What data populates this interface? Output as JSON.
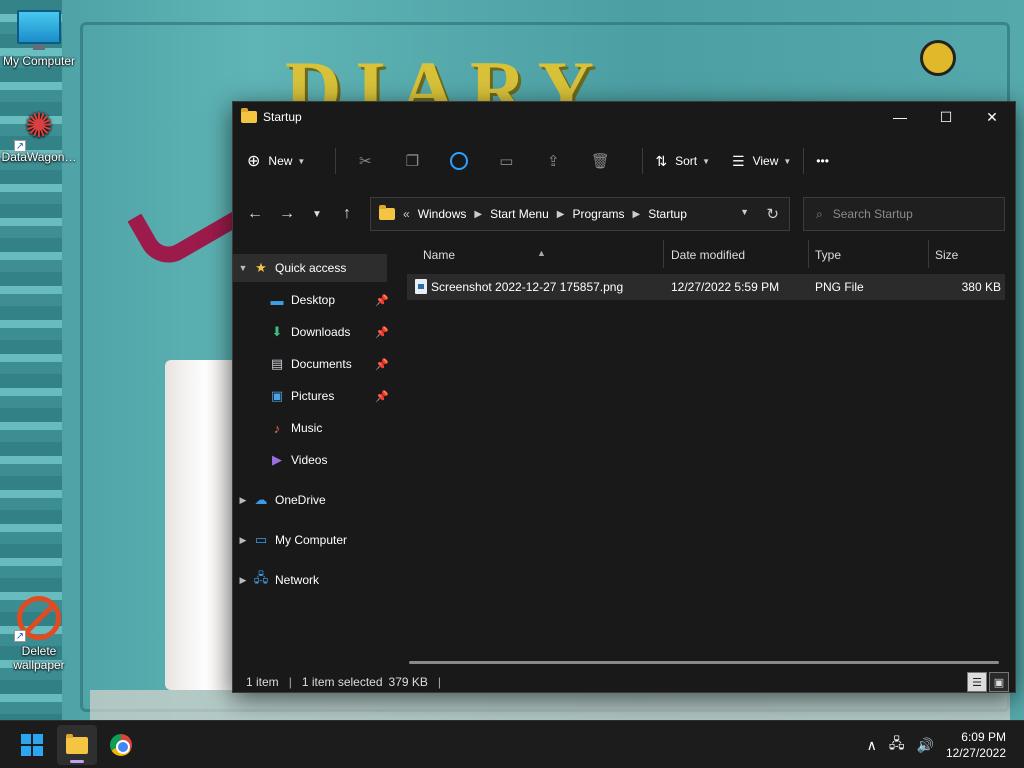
{
  "desktop": {
    "icons": [
      {
        "label": "My Computer",
        "icon": "monitor-icon"
      },
      {
        "label": "DataWagon…",
        "icon": "datawagon-icon"
      },
      {
        "label": "Delete wallpaper",
        "icon": "no-entry-icon"
      }
    ],
    "wallpaper_title": "DIARY"
  },
  "window": {
    "title": "Startup",
    "controls": {
      "minimize": "—",
      "maximize": "☐",
      "close": "✕"
    },
    "toolbar": {
      "new_label": "New",
      "sort_label": "Sort",
      "view_label": "View",
      "more_label": "•••"
    },
    "address": {
      "prefix": "«",
      "crumbs": [
        "Windows",
        "Start Menu",
        "Programs",
        "Startup"
      ]
    },
    "search": {
      "placeholder": "Search Startup"
    },
    "nav": {
      "quick_access": "Quick access",
      "items": [
        {
          "label": "Desktop",
          "icon": "desktop-icon",
          "pinned": true
        },
        {
          "label": "Downloads",
          "icon": "download-icon",
          "pinned": true
        },
        {
          "label": "Documents",
          "icon": "document-icon",
          "pinned": true
        },
        {
          "label": "Pictures",
          "icon": "pictures-icon",
          "pinned": true
        },
        {
          "label": "Music",
          "icon": "music-icon",
          "pinned": false
        },
        {
          "label": "Videos",
          "icon": "videos-icon",
          "pinned": false
        }
      ],
      "onedrive": "OneDrive",
      "my_computer": "My Computer",
      "network": "Network"
    },
    "columns": [
      "Name",
      "Date modified",
      "Type",
      "Size"
    ],
    "files": [
      {
        "name": "Screenshot 2022-12-27 175857.png",
        "date": "12/27/2022 5:59 PM",
        "type": "PNG File",
        "size": "380 KB"
      }
    ],
    "status": {
      "count": "1 item",
      "selected": "1 item selected",
      "size": "379 KB",
      "trail": "|"
    }
  },
  "taskbar": {
    "time": "6:09 PM",
    "date": "12/27/2022"
  }
}
